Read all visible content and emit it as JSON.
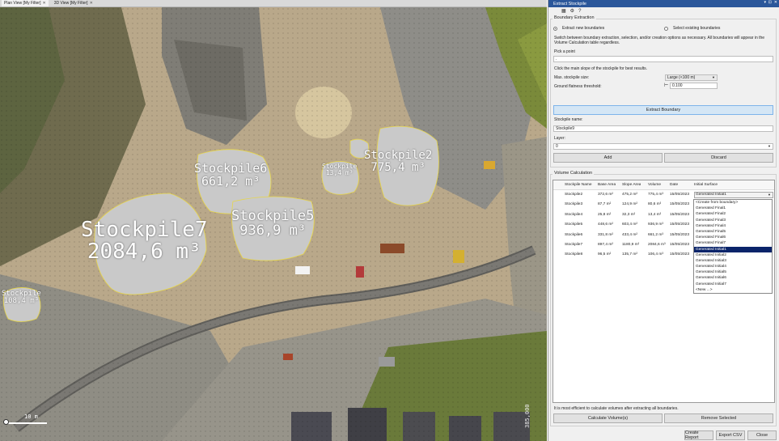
{
  "tabs": [
    {
      "label": "Plan View [My Filter]",
      "active": true
    },
    {
      "label": "3D View [My Filter]",
      "active": false
    }
  ],
  "map": {
    "stockpiles": [
      {
        "name": "Stockpile7",
        "volume": "2084,6 m³"
      },
      {
        "name": "Stockpile6",
        "volume": "661,2 m³"
      },
      {
        "name": "Stockpile5",
        "volume": "936,9 m³"
      },
      {
        "name": "Stockpile2",
        "volume": "775,4 m³"
      },
      {
        "name": "Stockpile",
        "volume": "13,4 m³"
      },
      {
        "name": "Stockpile",
        "volume": "108,4 m³"
      }
    ],
    "scale_label": "10 m",
    "coordinate_label": "385,000"
  },
  "panel": {
    "title": "Extract Stockpile",
    "boundary_group": "Boundary Extraction",
    "radio_extract": "Extract new boundaries",
    "radio_select": "Select existing boundaries",
    "help_text": "Switch between boundary extraction, selection, and/or creation options as necessary. All boundaries will appear in the Volume Calculation table regardless.",
    "pick_point_label": "Pick a point",
    "pick_point_value": ".",
    "click_hint": "Click the main slope of the stockpile for best results.",
    "max_size_label": "Max. stockpile size:",
    "max_size_value": "Large (<100 m)",
    "flatness_label": "Ground flatness threshold:",
    "flatness_value": "0.100",
    "extract_button": "Extract Boundary",
    "name_label": "Stockpile name:",
    "name_value": "Stockpile9",
    "layer_label": "Layer:",
    "layer_value": "0",
    "add_button": "Add",
    "discard_button": "Discard",
    "volume_group": "Volume Calculation",
    "columns": [
      "Stockpile Name",
      "Base Area",
      "Slope Area",
      "Volume",
      "Date",
      "Initial Surface"
    ],
    "rows": [
      {
        "name": "Stockpile2",
        "base": "372,6 m²",
        "slope": "475,2 m²",
        "volume": "775,4 m³",
        "date": "15/05/2023",
        "surface": "Generated Initial1"
      },
      {
        "name": "Stockpile3",
        "base": "87,7 m²",
        "slope": "124,9 m²",
        "volume": "80,6 m³",
        "date": "15/05/2023",
        "surface": ""
      },
      {
        "name": "Stockpile4",
        "base": "25,8 m²",
        "slope": "32,3 m²",
        "volume": "13,4 m³",
        "date": "15/05/2023",
        "surface": ""
      },
      {
        "name": "Stockpile5",
        "base": "448,6 m²",
        "slope": "603,4 m²",
        "volume": "936,9 m³",
        "date": "15/05/2023",
        "surface": ""
      },
      {
        "name": "Stockpile6",
        "base": "331,8 m²",
        "slope": "433,4 m²",
        "volume": "661,2 m³",
        "date": "15/05/2023",
        "surface": ""
      },
      {
        "name": "Stockpile7",
        "base": "897,4 m²",
        "slope": "1180,9 m²",
        "volume": "2084,6 m³",
        "date": "15/05/2023",
        "surface": ""
      },
      {
        "name": "Stockpile8",
        "base": "96,5 m²",
        "slope": "135,7 m²",
        "volume": "106,4 m³",
        "date": "15/05/2023",
        "surface": ""
      }
    ],
    "dropdown_options": [
      "<Create from boundary>",
      "Generated Final1",
      "Generated Final2",
      "Generated Final3",
      "Generated Final4",
      "Generated Final5",
      "Generated Final6",
      "Generated Final7",
      "Generated Initial1",
      "Generated Initial2",
      "Generated Initial3",
      "Generated Initial4",
      "Generated Initial5",
      "Generated Initial6",
      "Generated Initial7",
      "<New ...>"
    ],
    "dropdown_selected_index": 8,
    "footer_hint": "It is most efficient to calculate volumes after extracting all boundaries.",
    "calculate_button": "Calculate Volume(s)",
    "remove_button": "Remove Selected",
    "create_report_button": "Create Report",
    "export_csv_button": "Export CSV",
    "close_button": "Close"
  }
}
